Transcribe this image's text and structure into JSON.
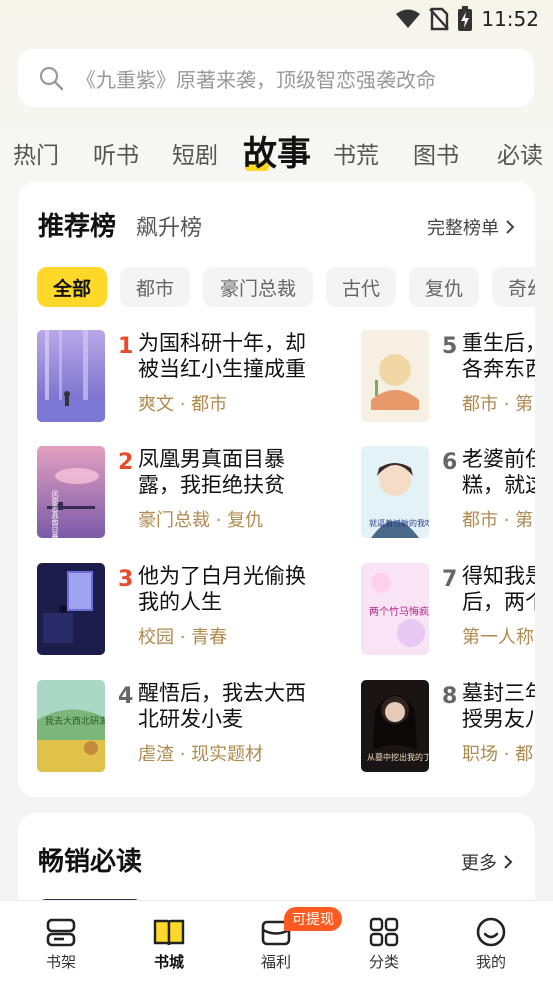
{
  "status_bar": {
    "time": "11:52",
    "icons": [
      "wifi-icon",
      "no-sim-icon",
      "battery-charging-icon"
    ]
  },
  "search": {
    "placeholder": "《九重紫》原著来袭，顶级智恋强袭改命",
    "icon": "search-icon"
  },
  "category_tabs": [
    {
      "label": "热门"
    },
    {
      "label": "听书"
    },
    {
      "label": "短剧"
    },
    {
      "label": "故事",
      "active": true
    },
    {
      "label": "书荒"
    },
    {
      "label": "图书"
    },
    {
      "label": "必读"
    }
  ],
  "ranking": {
    "title": "推荐榜",
    "subtitle": "飙升榜",
    "full_list_label": "完整榜单",
    "filters": [
      {
        "label": "全部",
        "active": true
      },
      {
        "label": "都市"
      },
      {
        "label": "豪门总裁"
      },
      {
        "label": "古代"
      },
      {
        "label": "复仇"
      },
      {
        "label": "奇幻"
      }
    ],
    "books": [
      {
        "rank": "1",
        "title_lines": [
          "为国科研十年，却",
          "被当红小生撞成重"
        ],
        "tags": "爽文 · 都市"
      },
      {
        "rank": "2",
        "title_lines": [
          "凤凰男真面目暴",
          "露，我拒绝扶贫"
        ],
        "tags": "豪门总裁 · 复仇"
      },
      {
        "rank": "3",
        "title_lines": [
          "他为了白月光偷换",
          "我的人生"
        ],
        "tags": "校园 · 青春"
      },
      {
        "rank": "4",
        "title_lines": [
          "醒悟后，我去大西",
          "北研发小麦"
        ],
        "tags": "虐渣 · 现实题材"
      },
      {
        "rank": "5",
        "title_lines": [
          "重生后，",
          "各奔东西"
        ],
        "tags": "都市 · 第"
      },
      {
        "rank": "6",
        "title_lines": [
          "老婆前任",
          "糕，就这"
        ],
        "tags": "都市 · 第"
      },
      {
        "rank": "7",
        "title_lines": [
          "得知我是",
          "后，两个"
        ],
        "tags": "第一人称"
      },
      {
        "rank": "8",
        "title_lines": [
          "墓封三年",
          "授男友八"
        ],
        "tags": "职场 · 都"
      }
    ],
    "cover_texts": {
      "book2": "凤凰男真面目暴露",
      "book4": "我去大西北研发小麦",
      "book6": "就逼着过敏的我吃蛋糕",
      "book7": "两个竹马悔疯了",
      "book8": "从墓中挖出我的丁尸"
    }
  },
  "bestseller": {
    "title": "畅销必读",
    "more_label": "更多"
  },
  "bottom_nav": [
    {
      "label": "书架",
      "icon": "bookshelf-icon"
    },
    {
      "label": "书城",
      "icon": "book-open-icon",
      "active": true
    },
    {
      "label": "福利",
      "icon": "wallet-icon",
      "badge": "可提现"
    },
    {
      "label": "分类",
      "icon": "grid-icon"
    },
    {
      "label": "我的",
      "icon": "smile-face-icon"
    }
  ],
  "colors": {
    "accent_yellow": "#ffd82a",
    "rank_hot": "#e84a2b",
    "tag_brown": "#b08a4e",
    "badge_orange": "#ff5a1f"
  }
}
